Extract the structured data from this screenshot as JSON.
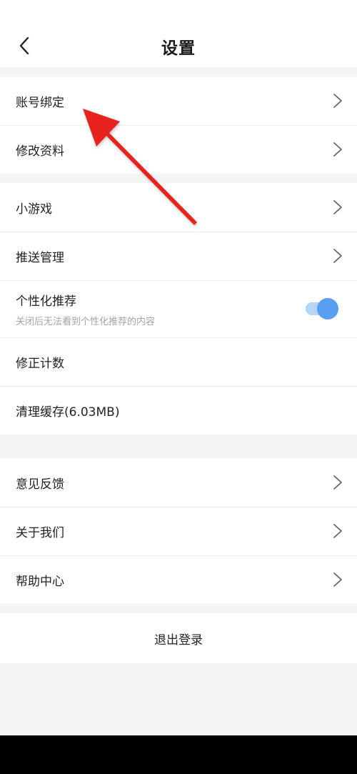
{
  "header": {
    "title": "设置"
  },
  "group1": [
    {
      "label": "账号绑定"
    },
    {
      "label": "修改资料"
    }
  ],
  "group2": {
    "mini_games": "小游戏",
    "push": "推送管理",
    "personalized": {
      "label": "个性化推荐",
      "subtitle": "关闭后无法看到个性化推荐的内容",
      "enabled": true
    },
    "fix_count": "修正计数",
    "clear_cache": "清理缓存(6.03MB)"
  },
  "group3": [
    {
      "label": "意见反馈"
    },
    {
      "label": "关于我们"
    },
    {
      "label": "帮助中心"
    }
  ],
  "logout": {
    "label": "退出登录"
  },
  "colors": {
    "accent": "#5a9ef0",
    "accent_track": "#b7d3f7",
    "annotation_arrow": "#e8231c",
    "background": "#f5f5f5"
  }
}
